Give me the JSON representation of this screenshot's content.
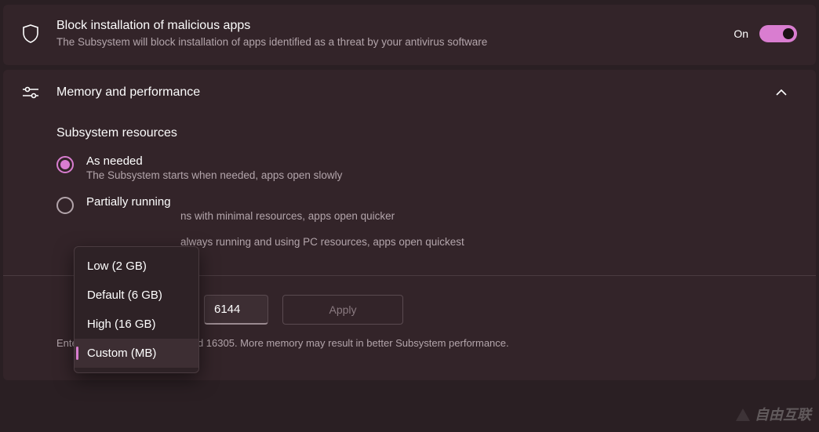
{
  "security": {
    "title": "Block installation of malicious apps",
    "subtitle": "The Subsystem will block installation of apps identified as a threat by your antivirus software",
    "toggle_label": "On"
  },
  "performance": {
    "header": "Memory and performance",
    "section_title": "Subsystem resources",
    "options": [
      {
        "label": "As needed",
        "desc": "The Subsystem starts when needed, apps open slowly",
        "selected": true
      },
      {
        "label": "Partially running",
        "desc": "ns with minimal resources, apps open quicker",
        "selected": false
      },
      {
        "label": "",
        "desc": "always running and using PC resources, apps open quickest",
        "selected": false
      }
    ],
    "custom_value": "6144",
    "apply_label": "Apply",
    "helper": "Enter a value between 2048 and 16305. More memory may result in better Subsystem performance."
  },
  "dropdown": {
    "items": [
      {
        "label": "Low (2 GB)",
        "selected": false
      },
      {
        "label": "Default (6 GB)",
        "selected": false
      },
      {
        "label": "High (16 GB)",
        "selected": false
      },
      {
        "label": "Custom (MB)",
        "selected": true
      }
    ]
  },
  "watermark": "自由互联"
}
